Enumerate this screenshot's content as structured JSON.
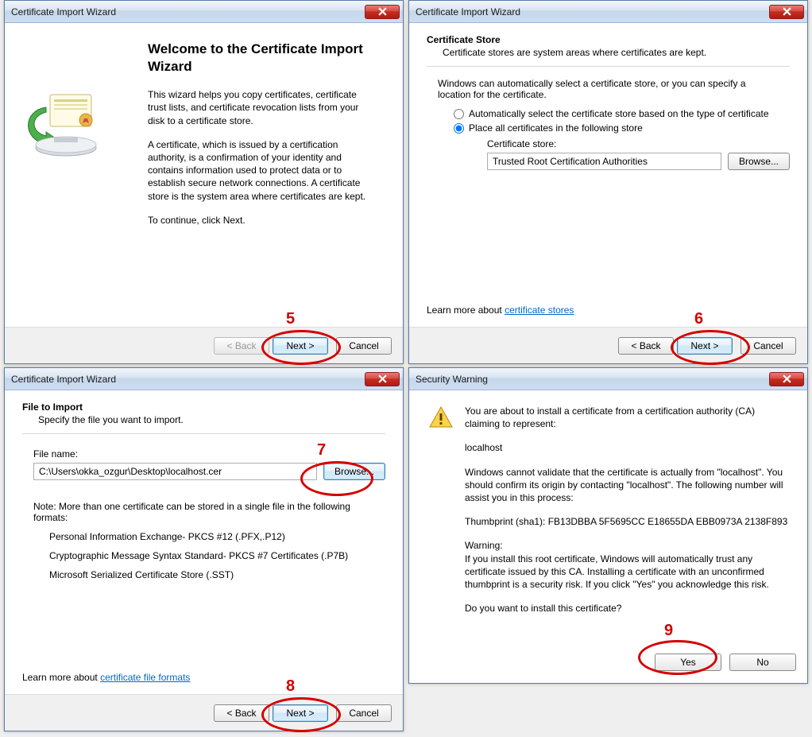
{
  "dialog1": {
    "title": "Certificate Import Wizard",
    "heading": "Welcome to the Certificate Import Wizard",
    "para1": "This wizard helps you copy certificates, certificate trust lists, and certificate revocation lists from your disk to a certificate store.",
    "para2": "A certificate, which is issued by a certification authority, is a confirmation of your identity and contains information used to protect data or to establish secure network connections. A certificate store is the system area where certificates are kept.",
    "para3": "To continue, click Next.",
    "back": "< Back",
    "next": "Next >",
    "cancel": "Cancel"
  },
  "dialog2": {
    "title": "Certificate Import Wizard",
    "section_heading": "Certificate Store",
    "section_sub": "Certificate stores are system areas where certificates are kept.",
    "intro": "Windows can automatically select a certificate store, or you can specify a location for the certificate.",
    "radio_auto": "Automatically select the certificate store based on the type of certificate",
    "radio_place": "Place all certificates in the following store",
    "store_label": "Certificate store:",
    "store_value": "Trusted Root Certification Authorities",
    "browse": "Browse...",
    "learn_prefix": "Learn more about ",
    "learn_link": "certificate stores",
    "back": "< Back",
    "next": "Next >",
    "cancel": "Cancel"
  },
  "dialog3": {
    "title": "Certificate Import Wizard",
    "section_heading": "File to Import",
    "section_sub": "Specify the file you want to import.",
    "filename_label": "File name:",
    "filename_value": "C:\\Users\\okka_ozgur\\Desktop\\localhost.cer",
    "browse": "Browse...",
    "note_prefix": "Note:  More than one certificate can be stored in a single file in the following formats:",
    "fmt1": "Personal Information Exchange- PKCS #12 (.PFX,.P12)",
    "fmt2": "Cryptographic Message Syntax Standard- PKCS #7 Certificates (.P7B)",
    "fmt3": "Microsoft Serialized Certificate Store (.SST)",
    "learn_prefix": "Learn more about ",
    "learn_link": "certificate file formats",
    "back": "< Back",
    "next": "Next >",
    "cancel": "Cancel"
  },
  "dialog4": {
    "title": "Security Warning",
    "p1": "You are about to install a certificate from a certification authority (CA) claiming to represent:",
    "host": "localhost",
    "p2a": "Windows cannot validate that the certificate is actually from \"localhost\". You should confirm its origin by contacting \"localhost\". The following number will assist you in this process:",
    "thumb": "Thumbprint (sha1): FB13DBBA 5F5695CC E18655DA EBB0973A 2138F893",
    "warn_label": "Warning:",
    "warning": "If you install this root certificate, Windows will automatically trust any certificate issued by this CA. Installing a certificate with an unconfirmed thumbprint is a security risk. If you click \"Yes\" you acknowledge this risk.",
    "question": "Do you want to install this certificate?",
    "yes": "Yes",
    "no": "No"
  },
  "annot": {
    "a5": "5",
    "a6": "6",
    "a7": "7",
    "a8": "8",
    "a9": "9"
  }
}
